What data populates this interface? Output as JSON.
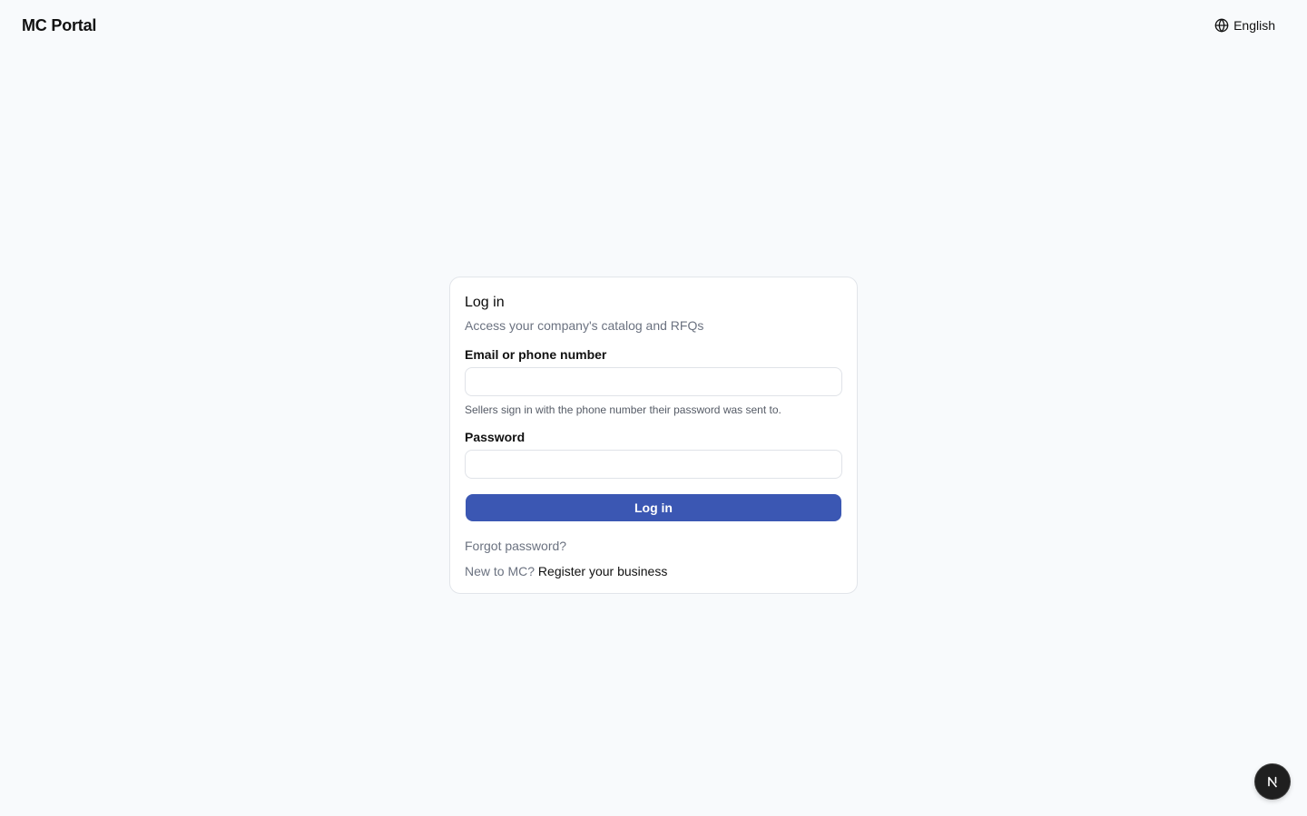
{
  "header": {
    "brand": "MC Portal",
    "language": "English",
    "language_icon": "globe-icon"
  },
  "login": {
    "title": "Log in",
    "subtitle": "Access your company's catalog and RFQs",
    "email_label": "Email or phone number",
    "email_value": "",
    "email_hint": "Sellers sign in with the phone number their password was sent to.",
    "password_label": "Password",
    "password_value": "",
    "submit_label": "Log in",
    "forgot_link": "Forgot password?",
    "register_prompt": "New to MC?",
    "register_link": "Register your business"
  },
  "dev_badge": {
    "icon": "nextjs-icon"
  },
  "colors": {
    "background": "#f8fafc",
    "primary": "#3b57b3",
    "card_border": "#e2e5ea",
    "muted_text": "#6b7280"
  }
}
